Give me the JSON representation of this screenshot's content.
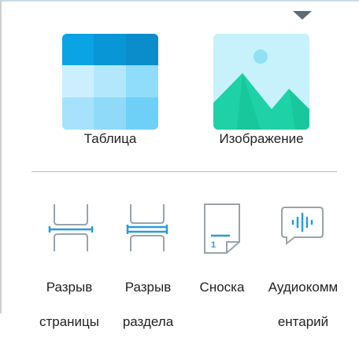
{
  "insert_panel": {
    "big_items": [
      {
        "label": "Таблица",
        "icon": "table-icon"
      },
      {
        "label": "Изображение",
        "icon": "image-icon"
      }
    ],
    "small_items": [
      {
        "label_line1": "Разрыв",
        "label_line2": "страницы",
        "icon": "page-break-icon"
      },
      {
        "label_line1": "Разрыв",
        "label_line2": "раздела",
        "icon": "section-break-icon"
      },
      {
        "label_line1": "Сноска",
        "label_line2": "",
        "icon": "footnote-icon"
      },
      {
        "label_line1": "Аудиокомм",
        "label_line2": "ентарий",
        "icon": "audio-comment-icon"
      }
    ],
    "footnote_number": "1"
  },
  "colors": {
    "accent": "#2a9bd8",
    "table_header": "#0aa3e3",
    "image_bg": "#c7f1fb",
    "mountain": "#1fd1a6"
  }
}
